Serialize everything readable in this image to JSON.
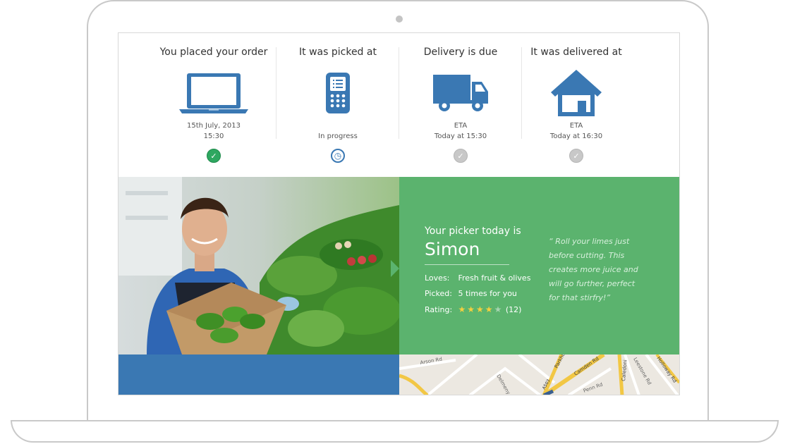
{
  "steps": [
    {
      "title": "You placed your order",
      "icon": "laptop-icon",
      "line1": "15th July, 2013",
      "line2": "15:30",
      "status": "done"
    },
    {
      "title": "It was picked at",
      "icon": "handheld-scanner-icon",
      "line1": "",
      "line2": "In progress",
      "status": "in-progress"
    },
    {
      "title": "Delivery is due",
      "icon": "truck-icon",
      "line1": "ETA",
      "line2": "Today at 15:30",
      "status": "pending"
    },
    {
      "title": "It was delivered at",
      "icon": "house-icon",
      "line1": "ETA",
      "line2": "Today at 16:30",
      "status": "pending"
    }
  ],
  "status_glyphs": {
    "done": "✓",
    "in-progress": "◷",
    "pending": "✓"
  },
  "picker": {
    "intro": "Your picker today is",
    "name": "Simon",
    "loves_label": "Loves:",
    "loves_value": "Fresh fruit & olives",
    "picked_label": "Picked:",
    "picked_value": "5 times for you",
    "rating_label": "Rating:",
    "rating_stars": 4,
    "rating_max": 5,
    "rating_count": "(12)",
    "quote": "“ Roll your limes just before cutting. This creates more juice and will go further, perfect for that stirfry!”"
  },
  "map_labels": [
    "Arson Rd",
    "Parkhu",
    "Camden Rd",
    "Caledoni",
    "Holloway Rd",
    "Penn Rd",
    "Delmeny Av",
    "Leestone Rd",
    "A503"
  ],
  "colors": {
    "accent_blue": "#3a78b3",
    "accent_green": "#5bb36e",
    "done_green": "#2ea760",
    "pending_grey": "#c8c8c8",
    "star_yellow": "#f4d03f"
  }
}
